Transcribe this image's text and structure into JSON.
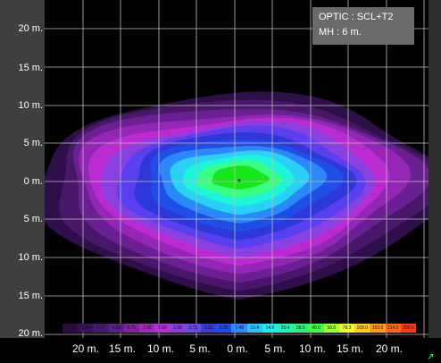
{
  "info": {
    "line1": "OPTIC : SCL+T2",
    "line2": "MH : 6 m."
  },
  "y_axis_labels": [
    "20 m.",
    "15 m.",
    "10 m.",
    "5 m.",
    "0 m.",
    "5 m.",
    "10 m.",
    "15 m.",
    "20 m."
  ],
  "x_axis_labels": [
    "20 m.",
    "15 m.",
    "10 m.",
    "5 m.",
    "0 m.",
    "5 m.",
    "10 m.",
    "15 m.",
    "20 m."
  ],
  "legend": [
    {
      "label": "0.10",
      "color": "#2a0c3e"
    },
    {
      "label": "0.20",
      "color": "#3b1258"
    },
    {
      "label": "0.30",
      "color": "#4a1a72"
    },
    {
      "label": "0.50",
      "color": "#5b2288"
    },
    {
      "label": "0.75",
      "color": "#80259e"
    },
    {
      "label": "1.00",
      "color": "#a02aba"
    },
    {
      "label": "1.50",
      "color": "#b530d0"
    },
    {
      "label": "1.95",
      "color": "#8a3fd8"
    },
    {
      "label": "2.73",
      "color": "#6a4ae0"
    },
    {
      "label": "3.82",
      "color": "#3a3ccc"
    },
    {
      "label": "5.35",
      "color": "#1e4cf0"
    },
    {
      "label": "7.48",
      "color": "#2f8cff"
    },
    {
      "label": "10.4",
      "color": "#29c6f5"
    },
    {
      "label": "14.6",
      "color": "#1bf0e8"
    },
    {
      "label": "20.4",
      "color": "#20f5b5"
    },
    {
      "label": "28.5",
      "color": "#30f080"
    },
    {
      "label": "40.0",
      "color": "#40ff40"
    },
    {
      "label": "56.0",
      "color": "#a0ff30"
    },
    {
      "label": "78.3",
      "color": "#eeff30"
    },
    {
      "label": "109.0",
      "color": "#ffd020"
    },
    {
      "label": "153.0",
      "color": "#ff9a20"
    },
    {
      "label": "214.0",
      "color": "#ff6a10"
    },
    {
      "label": "300.0",
      "color": "#ff3a10"
    }
  ],
  "contour_colors": [
    "#2f0f4a",
    "#491768",
    "#6a1f92",
    "#9326b5",
    "#b92bd0",
    "#8a3fe0",
    "#5a3ff0",
    "#2e38d8",
    "#1f4de8",
    "#2a88f8",
    "#2ad0f6",
    "#1cf5d8",
    "#3bff80",
    "#16e81a"
  ]
}
